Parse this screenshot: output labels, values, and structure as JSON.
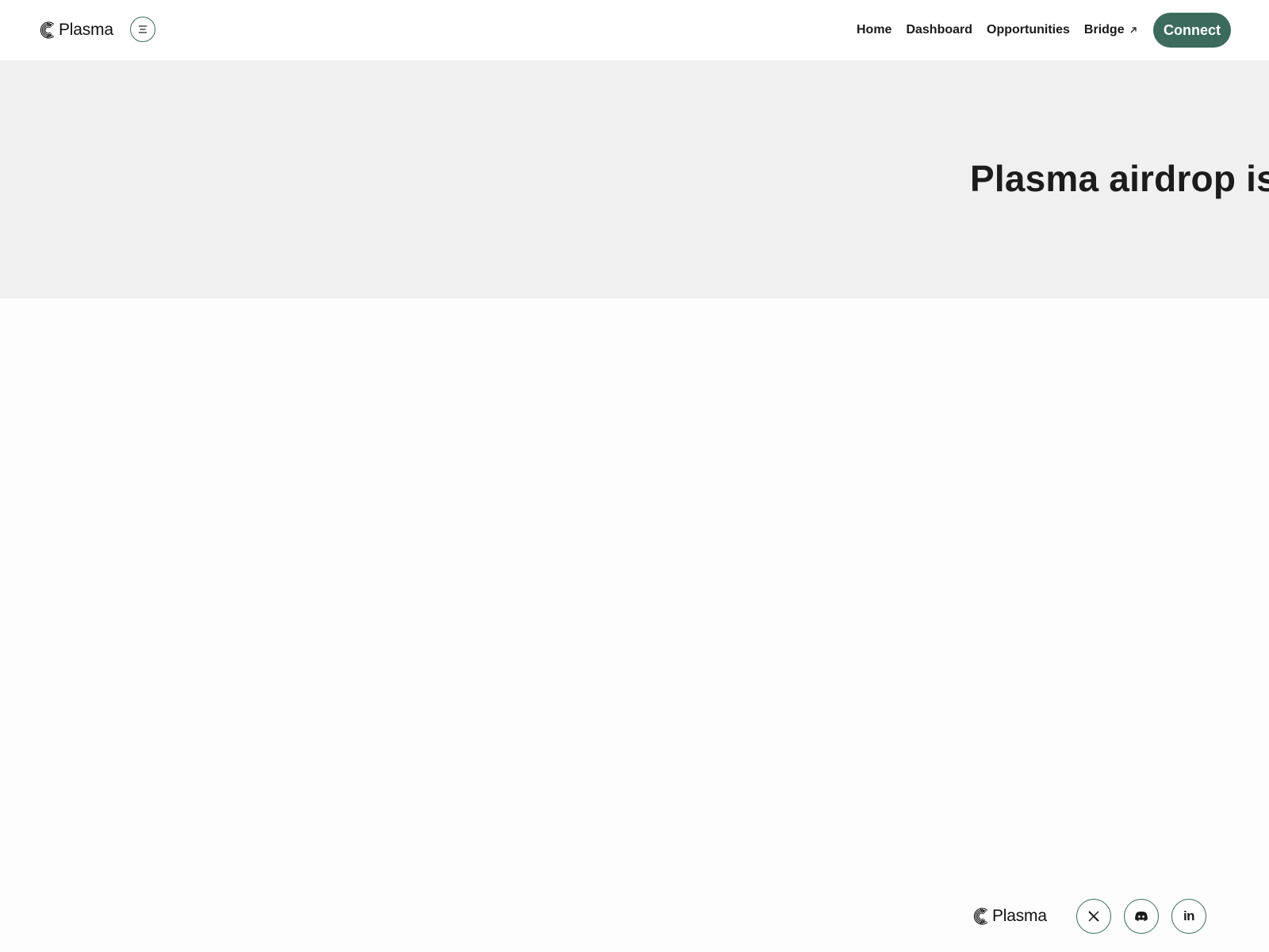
{
  "header": {
    "brand_name": "Plasma",
    "logo_icon": "plasma-logo-icon",
    "menu_icon": "menu-icon",
    "nav": [
      {
        "label": "Home"
      },
      {
        "label": "Dashboard"
      },
      {
        "label": "Opportunities"
      },
      {
        "label": "Bridge",
        "icon": "external-link-icon"
      }
    ],
    "connect_label": "Connect"
  },
  "hero": {
    "title": "Plasma airdrop is"
  },
  "footer": {
    "brand_name": "Plasma",
    "social": [
      {
        "icon": "x-twitter-icon"
      },
      {
        "icon": "discord-icon"
      },
      {
        "icon": "linkedin-icon",
        "text": "in"
      }
    ]
  },
  "colors": {
    "accent": "#3c6b5e",
    "hero_bg": "#f0f0f0",
    "page_bg": "#fdfdfd",
    "text": "#1a1a1a"
  }
}
